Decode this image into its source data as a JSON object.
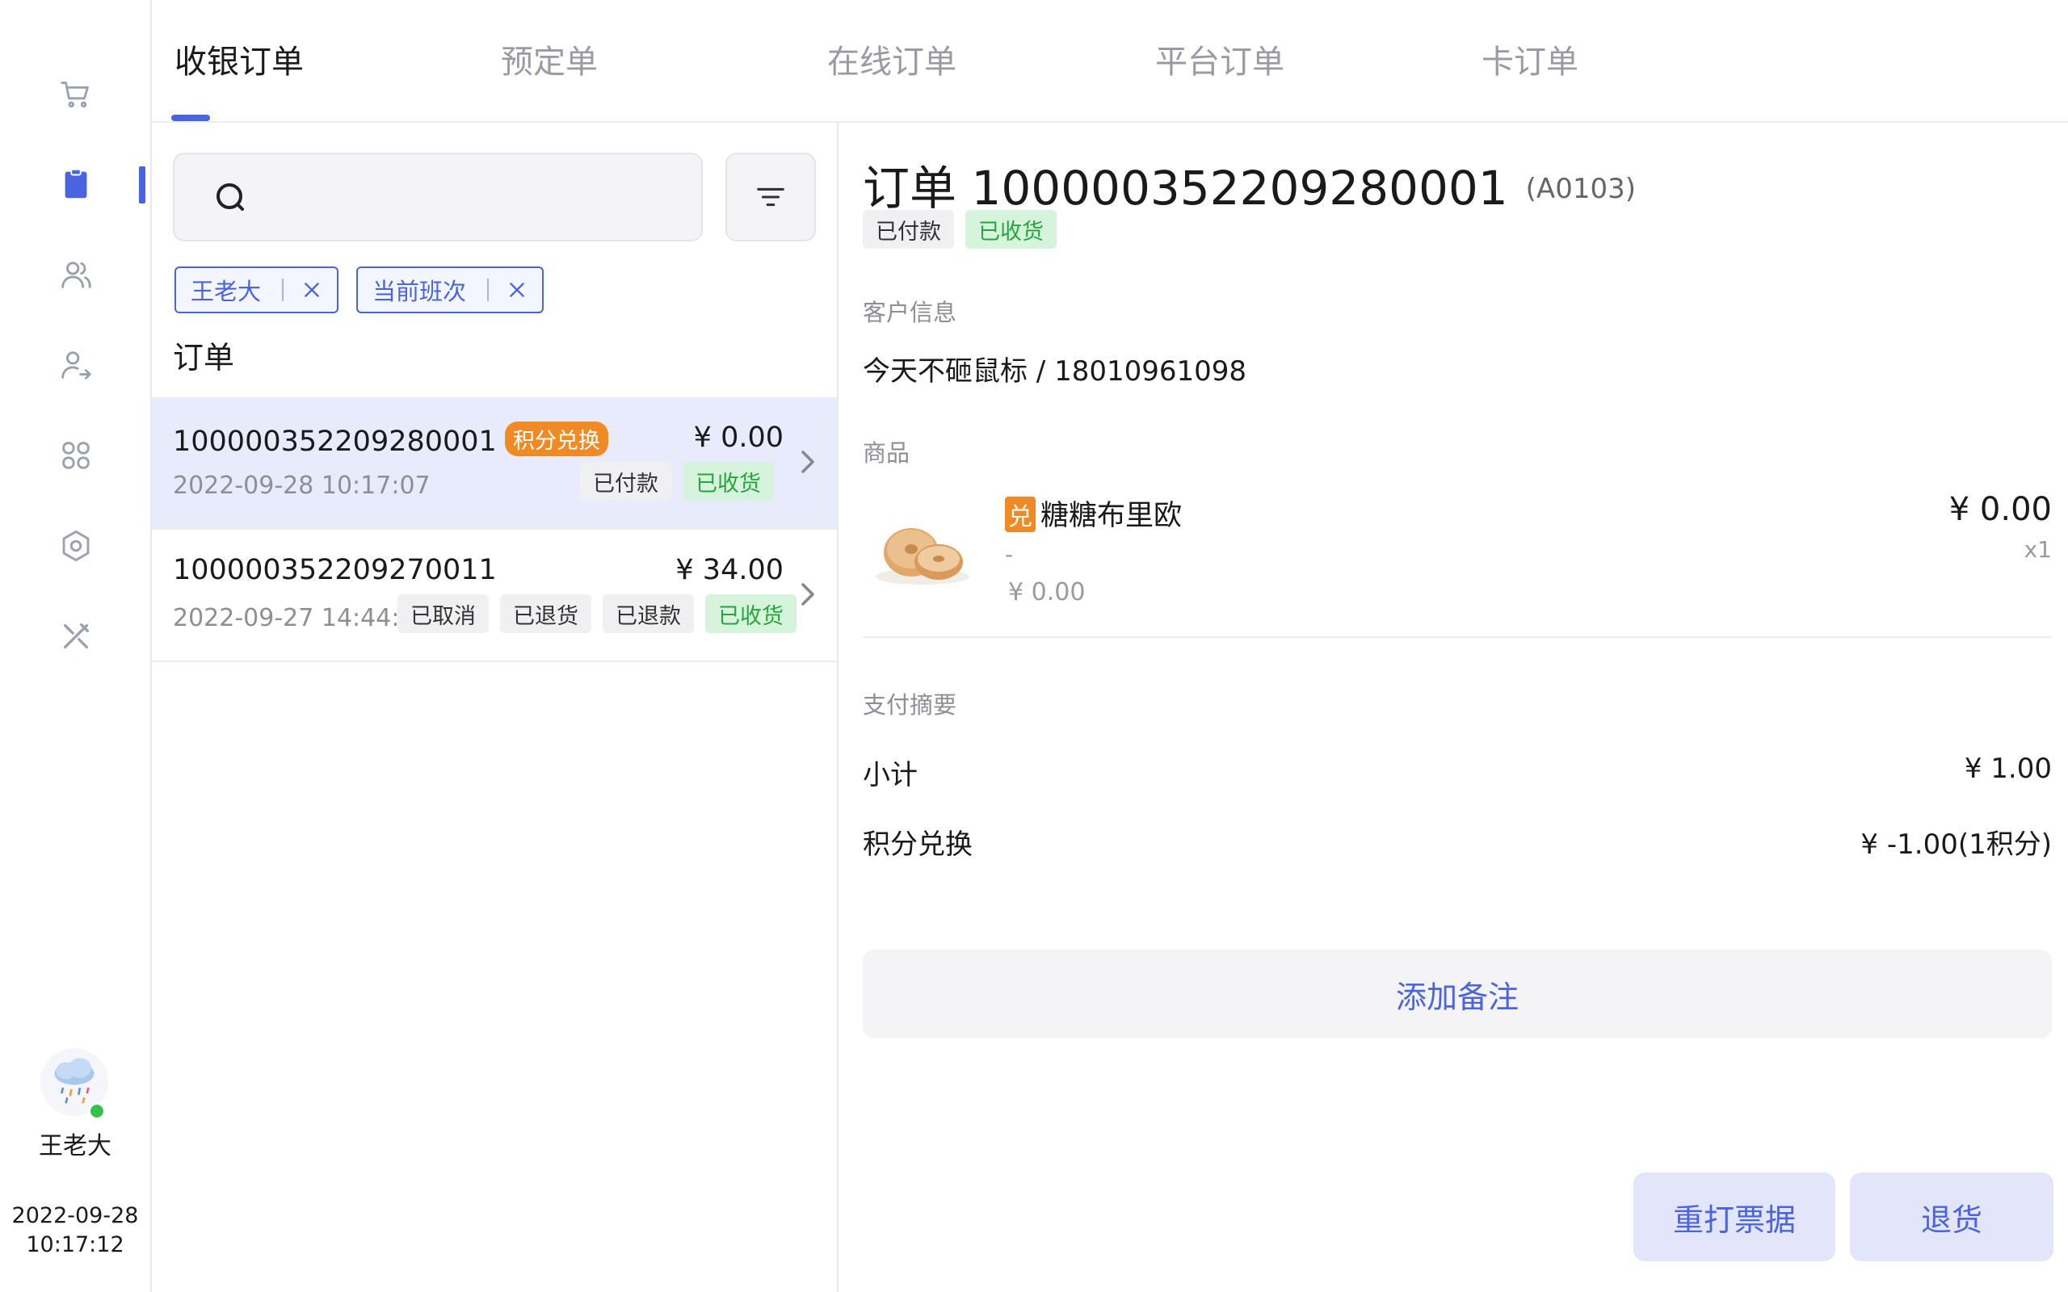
{
  "nav": {
    "items": [
      {
        "icon": "cart-icon"
      },
      {
        "icon": "clipboard-icon"
      },
      {
        "icon": "users-icon"
      },
      {
        "icon": "user-transfer-icon"
      },
      {
        "icon": "apps-icon"
      },
      {
        "icon": "gear-icon"
      },
      {
        "icon": "tools-icon"
      }
    ],
    "user_name": "王老大",
    "date": "2022-09-28",
    "time": "10:17:12"
  },
  "tabs": [
    {
      "label": "收银订单",
      "active": true
    },
    {
      "label": "预定单"
    },
    {
      "label": "在线订单"
    },
    {
      "label": "平台订单"
    },
    {
      "label": "卡订单"
    }
  ],
  "search": {
    "placeholder": ""
  },
  "filters": [
    {
      "label": "王老大"
    },
    {
      "label": "当前班次"
    }
  ],
  "list": {
    "title": "订单",
    "orders": [
      {
        "order_no": "100000352209280001",
        "badge": "积分兑换",
        "amount": "¥ 0.00",
        "time": "2022-09-28 10:17:07",
        "tags": [
          "已付款",
          "已收货"
        ]
      },
      {
        "order_no": "100000352209270011",
        "amount": "¥ 34.00",
        "time": "2022-09-27 14:44:43",
        "tags": [
          "已取消",
          "已退货",
          "已退款",
          "已收货"
        ]
      }
    ]
  },
  "detail": {
    "title": "订单 100000352209280001",
    "code": "(A0103)",
    "tags": [
      "已付款",
      "已收货"
    ],
    "customer_label": "客户信息",
    "customer": "今天不砸鼠标 / 18010961098",
    "product_label": "商品",
    "product": {
      "badge": "兑",
      "name": "糖糖布里欧",
      "sub": "-",
      "unit_price": "¥ 0.00",
      "price": "¥ 0.00",
      "qty": "x1"
    },
    "payment_label": "支付摘要",
    "subtotal_label": "小计",
    "subtotal": "¥ 1.00",
    "points_label": "积分兑换",
    "points": "¥ -1.00(1积分)",
    "add_note": "添加备注",
    "reprint": "重打票据",
    "refund": "退货"
  },
  "colors": {
    "accent": "#4a63e0",
    "success": "#27a53c",
    "orange": "#f08a24"
  }
}
